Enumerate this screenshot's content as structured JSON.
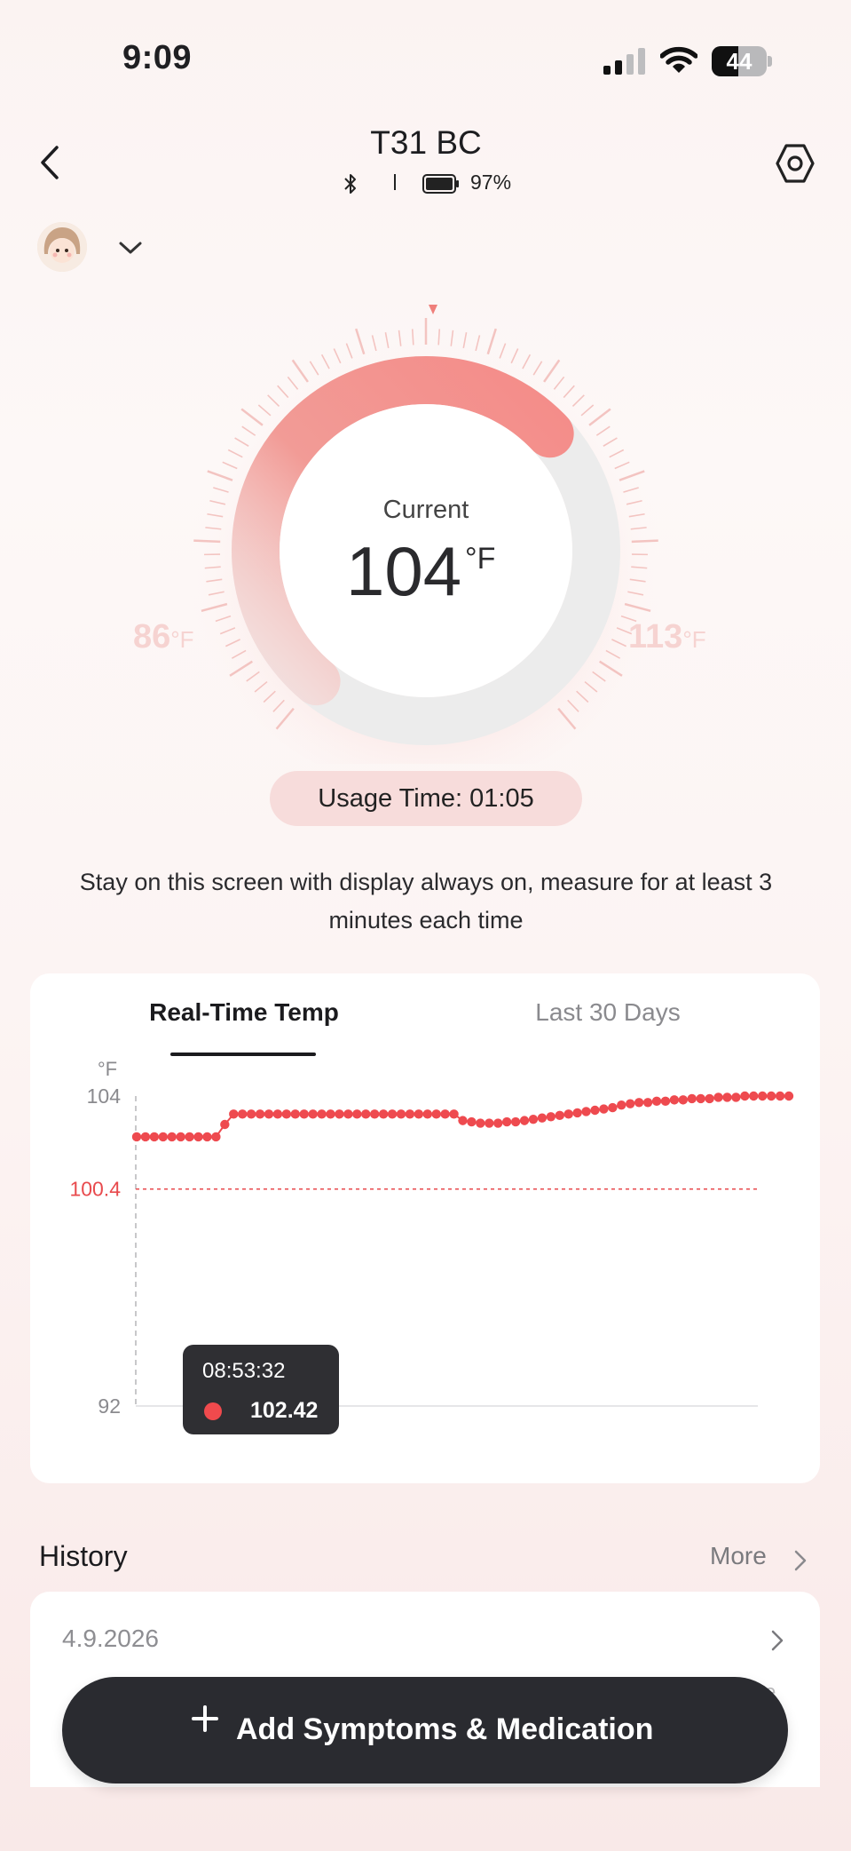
{
  "status_bar": {
    "time": "9:09",
    "battery_level": "44",
    "icons": [
      "signal-icon",
      "wifi-icon",
      "battery-icon"
    ]
  },
  "header": {
    "title": "T31 BC",
    "battery_percent": "97%",
    "icons": [
      "back-icon",
      "bluetooth-icon",
      "battery-icon",
      "settings-icon"
    ]
  },
  "profile": {
    "icons": [
      "avatar",
      "chevron-down-icon"
    ]
  },
  "dial": {
    "label": "Current",
    "value": "104",
    "unit": "°F",
    "min_label": "86",
    "max_label": "113",
    "range_unit": "°F",
    "range": [
      86,
      113
    ],
    "accent_color": "#f48c89",
    "track_color": "#ececec"
  },
  "usage": {
    "text": "Usage Time: 01:05"
  },
  "hint": "Stay on this screen with display always on, measure for at least 3 minutes each time",
  "tabs": [
    {
      "label": "Real-Time Temp",
      "active": true
    },
    {
      "label": "Last 30 Days",
      "active": false
    }
  ],
  "chart_data": {
    "type": "scatter",
    "ylabel": "°F",
    "yticks": [
      "104",
      "100.4",
      "92"
    ],
    "ylim": [
      92,
      104
    ],
    "threshold": 100.4,
    "threshold_color": "#e84a4d",
    "series_color": "#ee4a4f",
    "grid": false,
    "x": [
      1,
      2,
      3,
      4,
      5,
      6,
      7,
      8,
      9,
      10,
      11,
      12,
      13,
      14,
      15,
      16,
      17,
      18,
      19,
      20,
      21,
      22,
      23,
      24,
      25,
      26,
      27,
      28,
      29,
      30,
      31,
      32,
      33,
      34,
      35,
      36,
      37,
      38,
      39,
      40,
      41,
      42,
      43,
      44,
      45,
      46,
      47,
      48,
      49,
      50,
      51,
      52,
      53,
      54,
      55,
      56,
      57,
      58,
      59,
      60,
      61,
      62,
      63,
      64,
      65,
      66,
      67,
      68,
      69,
      70,
      71,
      72,
      73,
      74,
      75
    ],
    "values": [
      102.42,
      102.42,
      102.42,
      102.42,
      102.42,
      102.42,
      102.42,
      102.42,
      102.42,
      102.42,
      102.9,
      103.3,
      103.3,
      103.3,
      103.3,
      103.3,
      103.3,
      103.3,
      103.3,
      103.3,
      103.3,
      103.3,
      103.3,
      103.3,
      103.3,
      103.3,
      103.3,
      103.3,
      103.3,
      103.3,
      103.3,
      103.3,
      103.3,
      103.3,
      103.3,
      103.3,
      103.3,
      103.05,
      103.0,
      102.95,
      102.95,
      102.95,
      103.0,
      103.0,
      103.05,
      103.1,
      103.15,
      103.2,
      103.25,
      103.3,
      103.35,
      103.4,
      103.45,
      103.5,
      103.55,
      103.65,
      103.7,
      103.75,
      103.75,
      103.8,
      103.8,
      103.85,
      103.85,
      103.9,
      103.9,
      103.9,
      103.95,
      103.95,
      103.95,
      104.0,
      104.0,
      104.0,
      104.0,
      104.0,
      104.0
    ],
    "selected_index": 0
  },
  "tooltip": {
    "time": "08:53:32",
    "value": "102.42"
  },
  "history": {
    "title": "History",
    "more_label": "More",
    "items": [
      {
        "date": "4.9.2026"
      }
    ],
    "peek_text": "e"
  },
  "add_button": {
    "label": "Add Symptoms & Medication",
    "icon": "plus-icon"
  }
}
